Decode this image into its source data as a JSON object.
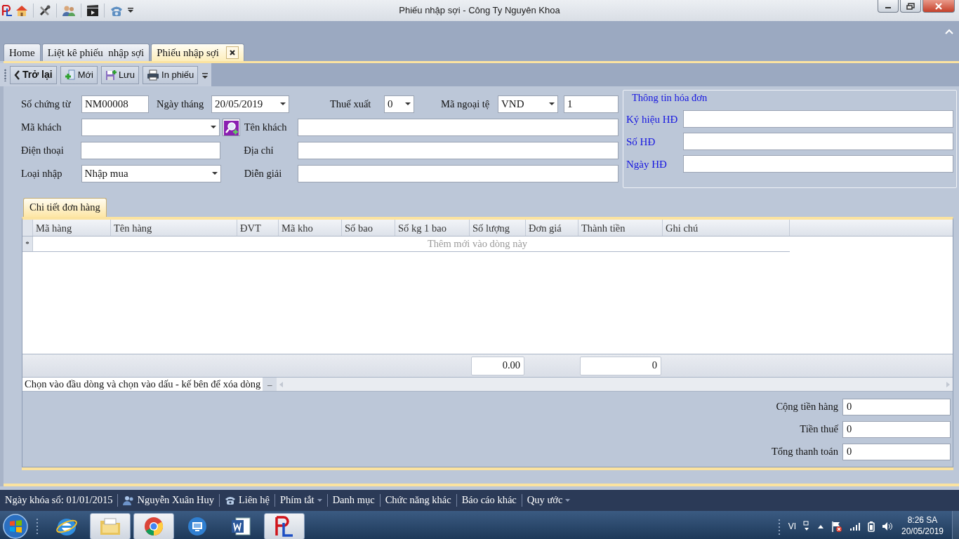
{
  "window": {
    "title": "Phiếu nhập sợi - Công Ty Nguyên Khoa"
  },
  "tabs": [
    {
      "label": "Home",
      "selected": false
    },
    {
      "label": "Liệt kê phiếu  nhập sợi",
      "selected": false
    },
    {
      "label": "Phiếu nhập sợi",
      "selected": true,
      "closable": true
    }
  ],
  "toolbar": [
    {
      "label": "Trở lại",
      "kind": "back"
    },
    {
      "label": "Mới",
      "kind": "new"
    },
    {
      "label": "Lưu",
      "kind": "save"
    },
    {
      "label": "In phiếu",
      "kind": "print"
    }
  ],
  "form": {
    "rows": [
      [
        {
          "label": "Số chứng từ",
          "value": "NM00008",
          "kind": "text"
        },
        {
          "label": "Ngày tháng",
          "value": "20/05/2019",
          "kind": "combo"
        },
        {
          "label": "Thuế xuất",
          "value": "0",
          "kind": "combo"
        },
        {
          "label": "Mã ngoại tệ",
          "value": "VND",
          "kind": "combo"
        },
        {
          "value": "1",
          "kind": "text"
        }
      ],
      [
        {
          "label": "Mã khách",
          "kind": "lookup"
        },
        {
          "label": "Tên khách",
          "kind": "text"
        }
      ],
      [
        {
          "label": "Điện thoại",
          "kind": "text"
        },
        {
          "label": "Địa chỉ",
          "kind": "text"
        }
      ],
      [
        {
          "label": "Loại nhập",
          "value": "Nhập mua",
          "kind": "combo"
        },
        {
          "label": "Diễn giải",
          "kind": "text"
        }
      ]
    ]
  },
  "invoice": {
    "title": "Thông tin hóa đơn",
    "fields": [
      {
        "label": "Ký hiệu HĐ"
      },
      {
        "label": "Số HĐ"
      },
      {
        "label": "Ngày HĐ"
      }
    ]
  },
  "detail": {
    "tab": {
      "label": "Chi tiết đơn hàng",
      "selected": true
    },
    "columns": [
      {
        "label": "Mã hàng"
      },
      {
        "label": "Tên hàng"
      },
      {
        "label": "ĐVT"
      },
      {
        "label": "Mã kho"
      },
      {
        "label": "Số bao"
      },
      {
        "label": "Số kg 1 bao"
      },
      {
        "label": "Số lượng",
        "footer": "0.00"
      },
      {
        "label": "Đơn giá"
      },
      {
        "label": "Thành tiền",
        "footer": "0"
      },
      {
        "label": "Ghi chú"
      }
    ],
    "new_row_marker": "*",
    "new_row_hint": "Thêm mới vào dòng này",
    "hint": "Chọn vào đầu dòng và chọn vào dấu - kế bên để xóa dòng",
    "delete_button": "–"
  },
  "totals": [
    {
      "label": "Cộng tiền hàng",
      "value": "0"
    },
    {
      "label": "Tiền thuế",
      "value": "0"
    },
    {
      "label": "Tổng thanh toán",
      "value": "0"
    }
  ],
  "status_bar": [
    {
      "label": "Ngày khóa sổ: 01/01/2015",
      "kind": "text"
    },
    {
      "label": "Nguyễn Xuân Huy",
      "kind": "user"
    },
    {
      "label": "Liên hệ",
      "kind": "phone"
    },
    {
      "label": "Phím tắt",
      "kind": "dropdown"
    },
    {
      "label": "Danh mục",
      "kind": "menu"
    },
    {
      "label": "Chức năng khác",
      "kind": "menu"
    },
    {
      "label": "Báo cáo khác",
      "kind": "menu"
    },
    {
      "label": "Quy ước",
      "kind": "dropdown"
    }
  ],
  "taskbar": {
    "apps": [
      {
        "kind": "ie",
        "running": false
      },
      {
        "kind": "folder",
        "running": true
      },
      {
        "kind": "chrome",
        "running": true
      },
      {
        "kind": "remote",
        "running": false
      },
      {
        "kind": "word",
        "running": false
      },
      {
        "kind": "app",
        "running": true
      }
    ],
    "language": "VI",
    "time": "8:26 SA",
    "date": "20/05/2019"
  }
}
